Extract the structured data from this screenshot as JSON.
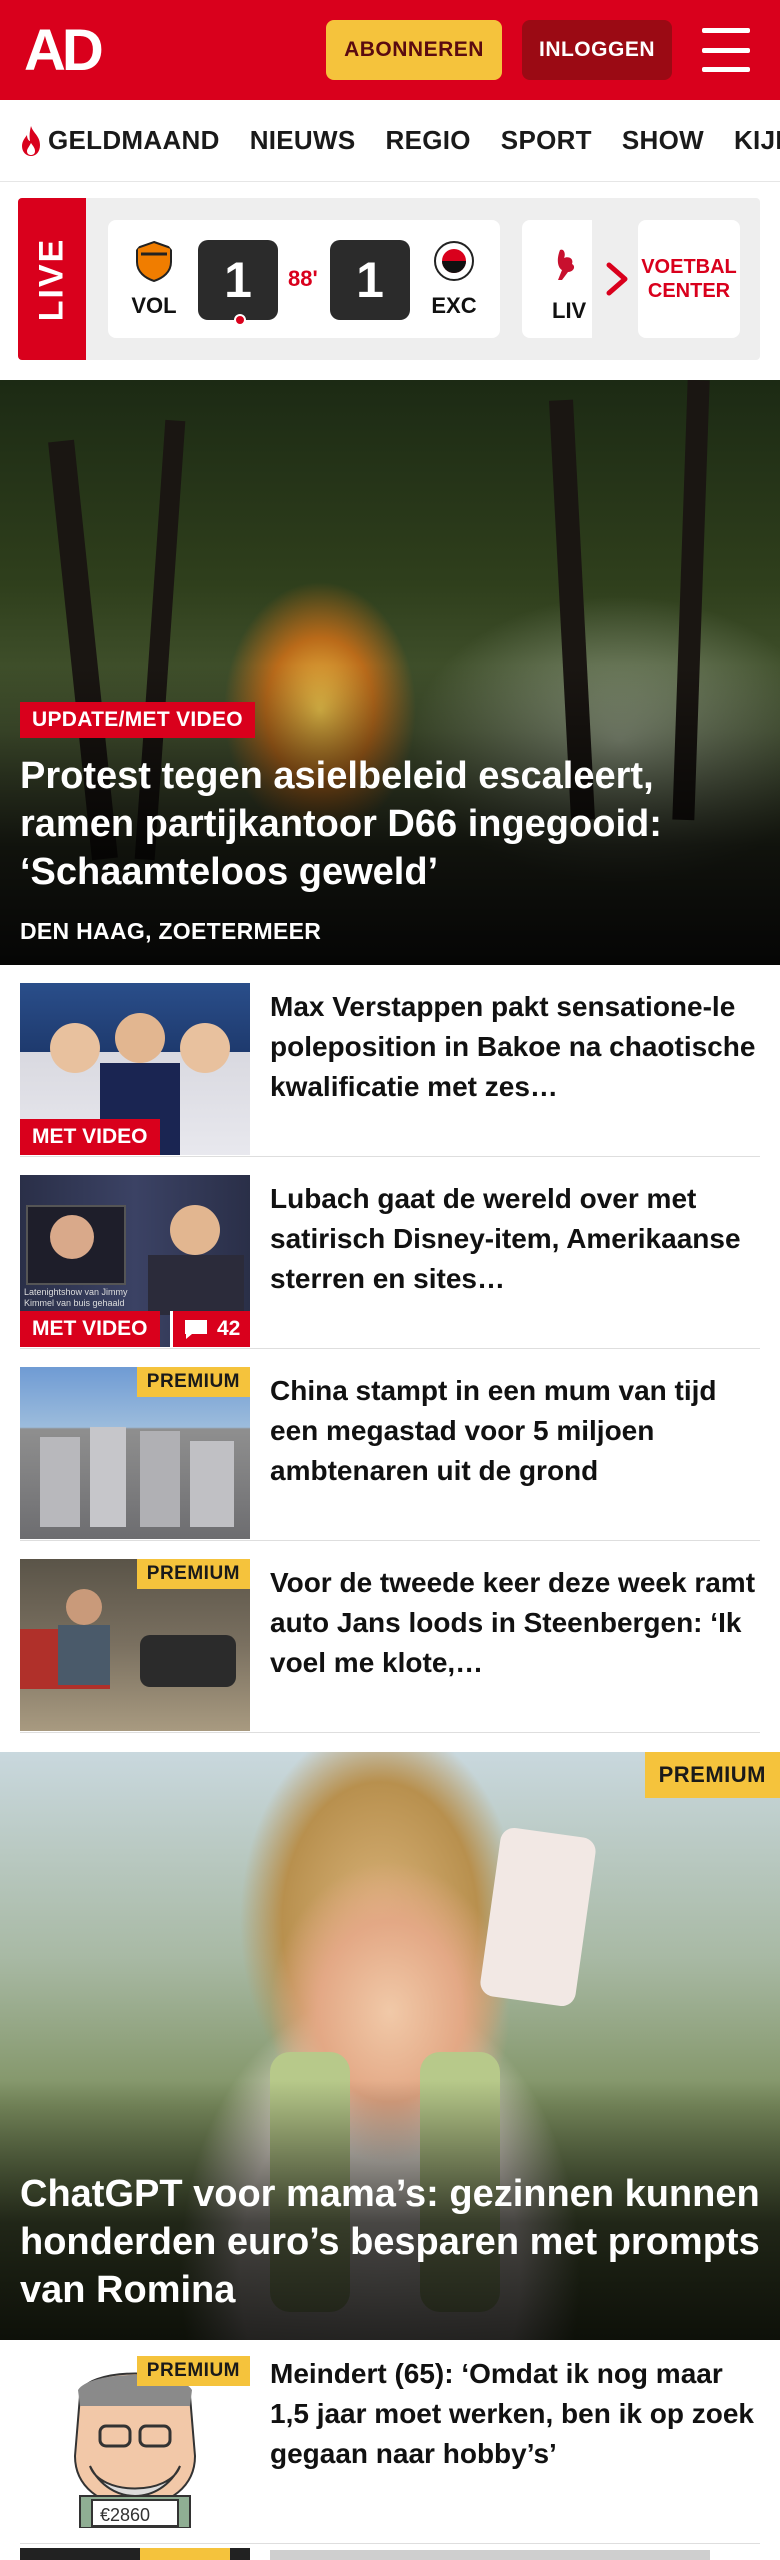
{
  "header": {
    "logo_text": "AD",
    "subscribe_label": "ABONNEREN",
    "login_label": "INLOGGEN",
    "menu_icon": "hamburger-icon"
  },
  "nav": {
    "items": [
      "GELDMAAND",
      "NIEUWS",
      "REGIO",
      "SPORT",
      "SHOW",
      "KIJK"
    ],
    "first_icon": "flame-icon"
  },
  "live": {
    "label": "LIVE",
    "match": {
      "home": "VOL",
      "away": "EXC",
      "home_score": "1",
      "away_score": "1",
      "minute": "88'"
    },
    "next_match_team": "LIV",
    "arrow_icon": "chevron-right-icon",
    "voetbal_center": "VOETBAL CENTER"
  },
  "hero": {
    "label": "UPDATE/MET VIDEO",
    "title": "Protest tegen asielbeleid escaleert, ramen partijkantoor D66 ingegooid: ‘Schaamteloos geweld’",
    "location": "DEN HAAG, ZOETERMEER"
  },
  "articles": [
    {
      "title": "Max Verstappen pakt sensatione-le poleposition in Bakoe na chaotische kwalificatie met zes…",
      "video_badge": "MET VIDEO"
    },
    {
      "title": "Lubach gaat de wereld over met satirisch Disney-item, Amerikaanse sterren en sites…",
      "video_badge": "MET VIDEO",
      "comments": "42",
      "thumb_caption": "Latenightshow van Jimmy Kimmel van buis gehaald"
    },
    {
      "title": "China stampt in een mum van tijd een megastad voor 5 miljoen ambtenaren uit de grond",
      "premium_badge": "PREMIUM"
    },
    {
      "title": "Voor de tweede keer deze week ramt auto Jans loods in Steenbergen: ‘Ik voel me klote,…",
      "premium_badge": "PREMIUM"
    }
  ],
  "feature": {
    "premium_badge": "PREMIUM",
    "title": "ChatGPT voor mama’s: gezinnen kunnen honderden euro’s besparen met prompts van Romina"
  },
  "article_last": {
    "title": "Meindert (65): ‘Omdat ik nog maar 1,5 jaar moet werken, ben ik op zoek gegaan naar hobby’s’",
    "premium_badge": "PREMIUM",
    "sign_text": "€2860"
  },
  "colors": {
    "brand_red": "#d9001c",
    "premium_yellow": "#f5c33c"
  }
}
